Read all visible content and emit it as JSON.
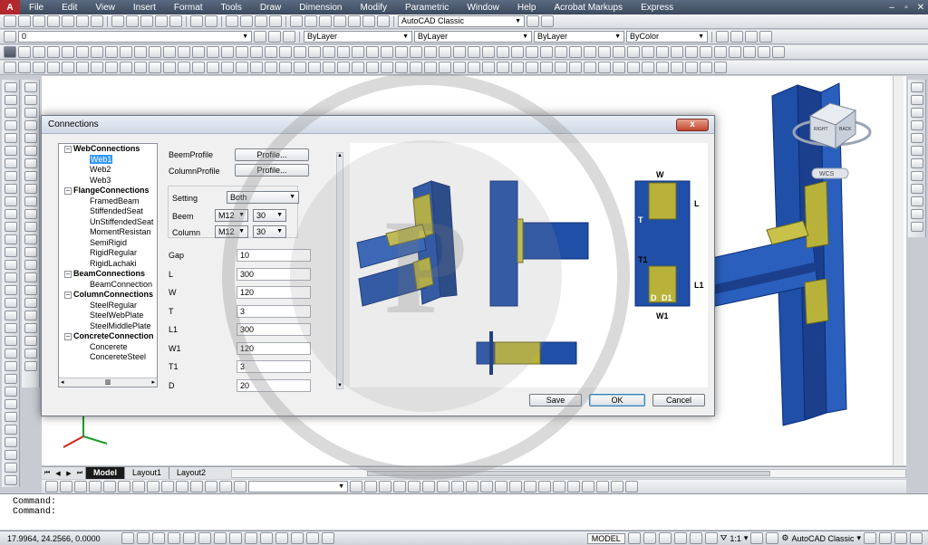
{
  "app": {
    "icon_label": "A"
  },
  "menu": [
    "File",
    "Edit",
    "View",
    "Insert",
    "Format",
    "Tools",
    "Draw",
    "Dimension",
    "Modify",
    "Parametric",
    "Window",
    "Help",
    "Acrobat Markups",
    "Express"
  ],
  "window_controls": {
    "min": "–",
    "restore": "▫",
    "close": "✕"
  },
  "toolbar": {
    "workspace": "AutoCAD Classic",
    "layer_value": "0",
    "color_value": "ByLayer",
    "linetype_value": "ByLayer",
    "lineweight_value": "ByLayer",
    "plotstyle_value": "ByColor"
  },
  "canvas": {
    "viewcube_top": "RIGHT",
    "viewcube_side": "BACK",
    "wcs_label": "WCS"
  },
  "tabs": [
    "Model",
    "Layout1",
    "Layout2"
  ],
  "command": {
    "line1": "Command:",
    "line2": "Command:"
  },
  "status": {
    "coords": "17.9964, 24.2566, 0.0000",
    "model": "MODEL",
    "scale": "1:1",
    "workspace": "AutoCAD Classic"
  },
  "dialog": {
    "title": "Connections",
    "close": "x",
    "tree": [
      {
        "label": "WebConnections",
        "children": [
          "Web1",
          "Web2",
          "Web3"
        ]
      },
      {
        "label": "FlangeConnections",
        "children": [
          "FramedBeam",
          "StiffendedSeat",
          "UnStiffendedSeat",
          "MomentResistan",
          "SemiRigid",
          "RigidRegular",
          "RigidLachaki"
        ]
      },
      {
        "label": "BeamConnections",
        "children": [
          "BeamConnection"
        ]
      },
      {
        "label": "ColumnConnections",
        "children": [
          "SteelRegular",
          "SteelWebPlate",
          "SteelMiddlePlate"
        ]
      },
      {
        "label": "ConcreteConnection",
        "children": [
          "Concerete",
          "ConcereteSteel"
        ]
      }
    ],
    "selected": "Web1",
    "tree_scroll": {
      "left": "◂",
      "mid": "▥",
      "right": "▸"
    },
    "beam_profile_label": "BeemProfile",
    "column_profile_label": "ColumnProfile",
    "profile_button": "Profile...",
    "setting_label": "Setting",
    "setting_value": "Both",
    "beam_label": "Beem",
    "beam_bolt": "M12",
    "beam_qty": "30",
    "column_label": "Column",
    "column_bolt": "M12",
    "column_qty": "30",
    "fields": [
      {
        "label": "Gap",
        "value": "10"
      },
      {
        "label": "L",
        "value": "300"
      },
      {
        "label": "W",
        "value": "120"
      },
      {
        "label": "T",
        "value": "3"
      },
      {
        "label": "L1",
        "value": "300"
      },
      {
        "label": "W1",
        "value": "120"
      },
      {
        "label": "T1",
        "value": "3"
      },
      {
        "label": "D",
        "value": "20"
      }
    ],
    "diagram_labels": {
      "w": "W",
      "l": "L",
      "t": "T",
      "t1": "T1",
      "l1": "L1",
      "d": "D",
      "d1": "D1",
      "w1": "W1"
    },
    "buttons": {
      "save": "Save",
      "ok": "OK",
      "cancel": "Cancel"
    }
  },
  "colors": {
    "steel_blue": "#1f4fa6",
    "plate_olive": "#b8b23a",
    "dark_blue": "#0b2f7a"
  }
}
